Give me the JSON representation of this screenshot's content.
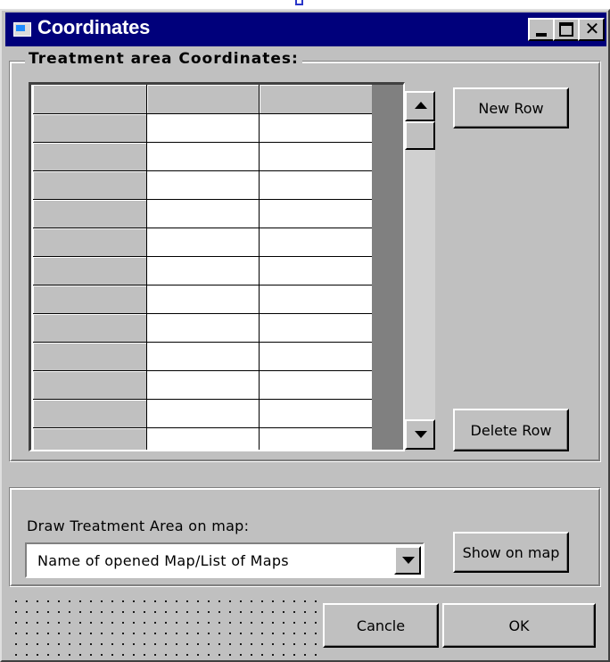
{
  "window": {
    "title": "Coordinates",
    "controls": {
      "minimize": "minimize",
      "maximize": "maximize",
      "close": "close"
    }
  },
  "treatment_group": {
    "legend": "Treatment area Coordinates:"
  },
  "grid": {
    "visible_rows": 12,
    "columns": [
      "",
      "",
      ""
    ]
  },
  "buttons": {
    "new_row": "New Row",
    "delete_row": "Delete Row",
    "show_on_map": "Show on map",
    "cancel": "Cancle",
    "ok": "OK"
  },
  "map_group": {
    "label": "Draw Treatment Area on map:",
    "selected_map": "Name of opened Map/List of Maps"
  },
  "colors": {
    "title_bar": "#00007b",
    "face": "#c0c0c0",
    "grid_empty_area": "#808080"
  },
  "icons": [
    "app-window-icon",
    "minimize-icon",
    "maximize-icon",
    "close-icon",
    "scroll-up-arrow-icon",
    "scroll-down-arrow-icon",
    "dropdown-arrow-icon"
  ]
}
